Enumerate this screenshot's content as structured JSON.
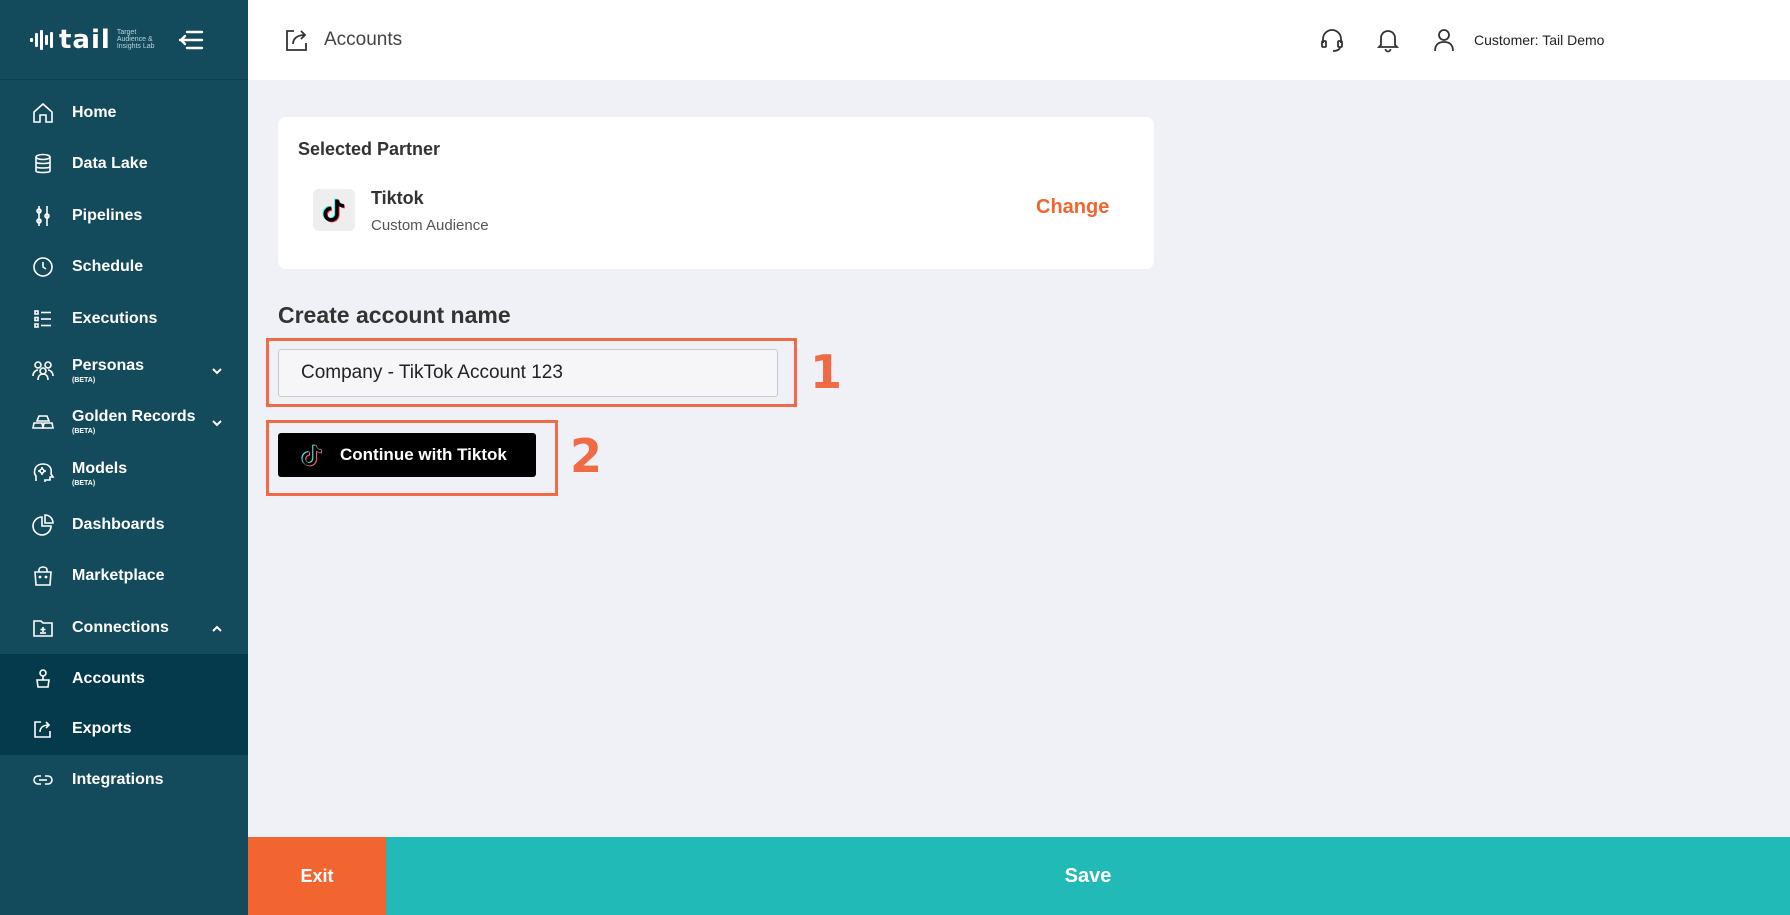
{
  "brand": {
    "logo_text": "tail",
    "logo_subtext": "Target Audience & Insights Lab"
  },
  "sidebar": {
    "items": [
      {
        "label": "Home",
        "icon": "home-icon"
      },
      {
        "label": "Data Lake",
        "icon": "database-icon"
      },
      {
        "label": "Pipelines",
        "icon": "pipelines-icon"
      },
      {
        "label": "Schedule",
        "icon": "clock-icon"
      },
      {
        "label": "Executions",
        "icon": "list-icon"
      },
      {
        "label": "Personas",
        "beta": "(BETA)",
        "icon": "users-icon"
      },
      {
        "label": "Golden Records",
        "beta": "(BETA)",
        "icon": "gold-bars-icon"
      },
      {
        "label": "Models",
        "beta": "(BETA)",
        "icon": "brain-icon"
      },
      {
        "label": "Dashboards",
        "icon": "pie-chart-icon"
      },
      {
        "label": "Marketplace",
        "icon": "shopping-bag-icon"
      },
      {
        "label": "Connections",
        "icon": "folder-icon"
      }
    ],
    "sub_items": [
      {
        "label": "Accounts",
        "icon": "account-icon"
      },
      {
        "label": "Exports",
        "icon": "export-icon"
      }
    ],
    "bottom_item": {
      "label": "Integrations",
      "icon": "link-icon"
    }
  },
  "header": {
    "title": "Accounts",
    "customer": "Customer: Tail Demo"
  },
  "partner_card": {
    "title": "Selected Partner",
    "partner_name": "Tiktok",
    "partner_type": "Custom Audience",
    "change_label": "Change"
  },
  "account_form": {
    "title": "Create account name",
    "input_value": "Company - TikTok Account 123",
    "button_label": "Continue with Tiktok"
  },
  "callouts": {
    "one": "1",
    "two": "2"
  },
  "footer": {
    "exit_label": "Exit",
    "save_label": "Save"
  },
  "colors": {
    "sidebar_bg": "#134a5c",
    "sidebar_active_bg": "#053a4c",
    "accent_orange": "#f26430",
    "save_teal": "#22bab6",
    "page_bg": "#f0f1f6"
  }
}
